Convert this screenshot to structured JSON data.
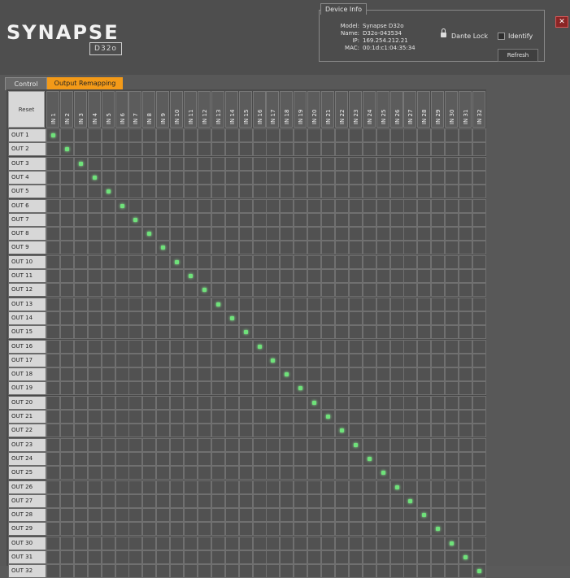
{
  "brand": {
    "name": "SYNAPSE",
    "model_badge": "D32o"
  },
  "device_info": {
    "tab_label": "Device Info",
    "rows": [
      {
        "label": "Model:",
        "value": "Synapse D32o"
      },
      {
        "label": "Name:",
        "value": "D32o-043534"
      },
      {
        "label": "IP:",
        "value": "169.254.212.21"
      },
      {
        "label": "MAC:",
        "value": "00:1d:c1:04:35:34"
      }
    ],
    "dante_lock_label": "Dante Lock",
    "identify_label": "Identify",
    "refresh_label": "Refresh"
  },
  "close_label": "✕",
  "tabs": [
    {
      "label": "Control",
      "active": false
    },
    {
      "label": "Output Remapping",
      "active": true
    }
  ],
  "matrix": {
    "reset_label": "Reset",
    "inputs": [
      "IN 1",
      "IN 2",
      "IN 3",
      "IN 4",
      "IN 5",
      "IN 6",
      "IN 7",
      "IN 8",
      "IN 9",
      "IN 10",
      "IN 11",
      "IN 12",
      "IN 13",
      "IN 14",
      "IN 15",
      "IN 16",
      "IN 17",
      "IN 18",
      "IN 19",
      "IN 20",
      "IN 21",
      "IN 22",
      "IN 23",
      "IN 24",
      "IN 25",
      "IN 26",
      "IN 27",
      "IN 28",
      "IN 29",
      "IN 30",
      "IN 31",
      "IN 32"
    ],
    "outputs": [
      "OUT 1",
      "OUT 2",
      "OUT 3",
      "OUT 4",
      "OUT 5",
      "OUT 6",
      "OUT 7",
      "OUT 8",
      "OUT 9",
      "OUT 10",
      "OUT 11",
      "OUT 12",
      "OUT 13",
      "OUT 14",
      "OUT 15",
      "OUT 16",
      "OUT 17",
      "OUT 18",
      "OUT 19",
      "OUT 20",
      "OUT 21",
      "OUT 22",
      "OUT 23",
      "OUT 24",
      "OUT 25",
      "OUT 26",
      "OUT 27",
      "OUT 28",
      "OUT 29",
      "OUT 30",
      "OUT 31",
      "OUT 32"
    ],
    "routing": [
      [
        1,
        1
      ],
      [
        2,
        2
      ],
      [
        3,
        3
      ],
      [
        4,
        4
      ],
      [
        5,
        5
      ],
      [
        6,
        6
      ],
      [
        7,
        7
      ],
      [
        8,
        8
      ],
      [
        9,
        9
      ],
      [
        10,
        10
      ],
      [
        11,
        11
      ],
      [
        12,
        12
      ],
      [
        13,
        13
      ],
      [
        14,
        14
      ],
      [
        15,
        15
      ],
      [
        16,
        16
      ],
      [
        17,
        17
      ],
      [
        18,
        18
      ],
      [
        19,
        19
      ],
      [
        20,
        20
      ],
      [
        21,
        21
      ],
      [
        22,
        22
      ],
      [
        23,
        23
      ],
      [
        24,
        24
      ],
      [
        25,
        25
      ],
      [
        26,
        26
      ],
      [
        27,
        27
      ],
      [
        28,
        28
      ],
      [
        29,
        29
      ],
      [
        30,
        30
      ],
      [
        31,
        31
      ],
      [
        32,
        32
      ]
    ]
  },
  "colors": {
    "active_tab": "#f39a18",
    "led_on": "#6fe27a"
  }
}
